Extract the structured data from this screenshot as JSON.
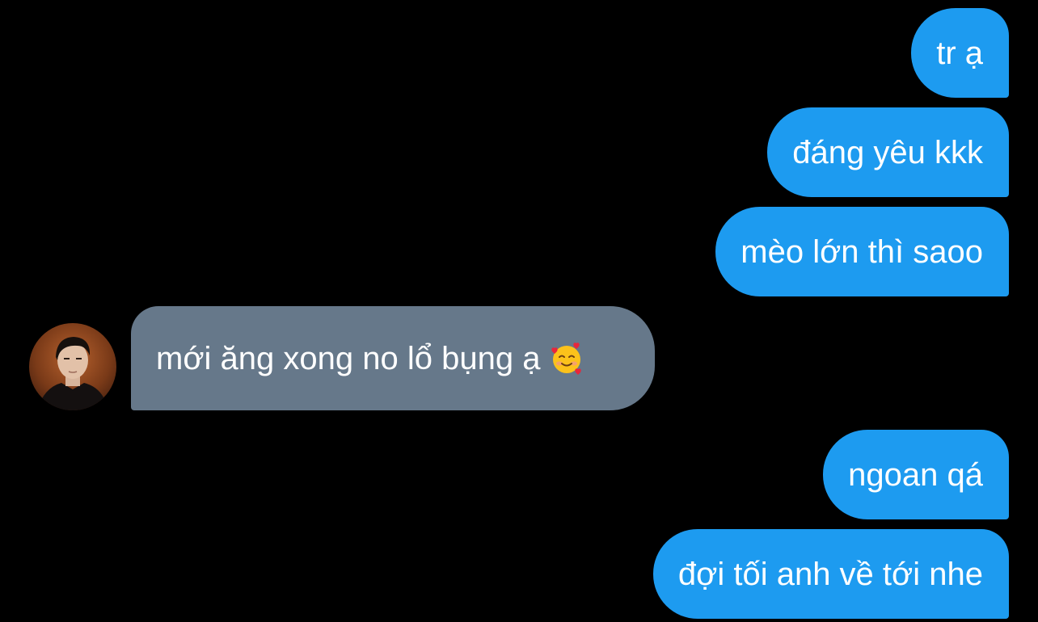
{
  "colors": {
    "background": "#000000",
    "outgoing_bubble": "#1d9bf0",
    "incoming_bubble": "#66788a",
    "text": "#ffffff"
  },
  "messages": {
    "m1": {
      "direction": "outgoing",
      "text": "tr ạ"
    },
    "m2": {
      "direction": "outgoing",
      "text": "đáng yêu kkk"
    },
    "m3": {
      "direction": "outgoing",
      "text": "mèo lớn thì saoo"
    },
    "m4": {
      "direction": "incoming",
      "text": "mới ăng xong no lổ bụng ạ",
      "emoji": "smiling-face-with-hearts"
    },
    "m5": {
      "direction": "outgoing",
      "text": "ngoan qá"
    },
    "m6": {
      "direction": "outgoing",
      "text": "đợi tối anh về tới nhe"
    }
  },
  "avatar": {
    "icon": "user-avatar"
  }
}
